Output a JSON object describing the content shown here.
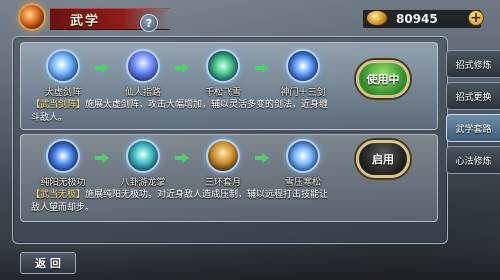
{
  "header": {
    "title": "武学",
    "help_label": "?",
    "currency_value": "80945",
    "currency_add_label": "+"
  },
  "sets": [
    {
      "skills": [
        {
          "name": "太虚剑阵",
          "icon": "sword-formation-icon"
        },
        {
          "name": "仙人指路",
          "icon": "immortal-finger-icon"
        },
        {
          "name": "千松飞雪",
          "icon": "flying-snow-icon"
        },
        {
          "name": "神门十三剑",
          "icon": "thirteen-swords-icon"
        }
      ],
      "desc_tag": "【武当剑阵】",
      "desc_text": "施展太虚剑阵，攻击大幅增加，辅以灵活多变的剑法，近身缠斗敌人。",
      "status_label": "使用中"
    },
    {
      "skills": [
        {
          "name": "纯阳无极功",
          "icon": "pure-yang-icon"
        },
        {
          "name": "八卦游龙掌",
          "icon": "dragon-palm-icon"
        },
        {
          "name": "三环套月",
          "icon": "locked-icon"
        },
        {
          "name": "雪压寒松",
          "icon": "snow-pine-icon"
        }
      ],
      "desc_tag": "【武当无极】",
      "desc_text": "施展纯阳无极功，对近身敌人造成压制，辅以远程打击技能让敌人望而却步。",
      "status_label": "启用"
    }
  ],
  "side_tabs": [
    {
      "label": "招式修炼",
      "active": false
    },
    {
      "label": "招式更换",
      "active": false
    },
    {
      "label": "武学套路",
      "active": true
    },
    {
      "label": "心法修炼",
      "active": false
    }
  ],
  "footer": {
    "back_label": "返 回"
  }
}
